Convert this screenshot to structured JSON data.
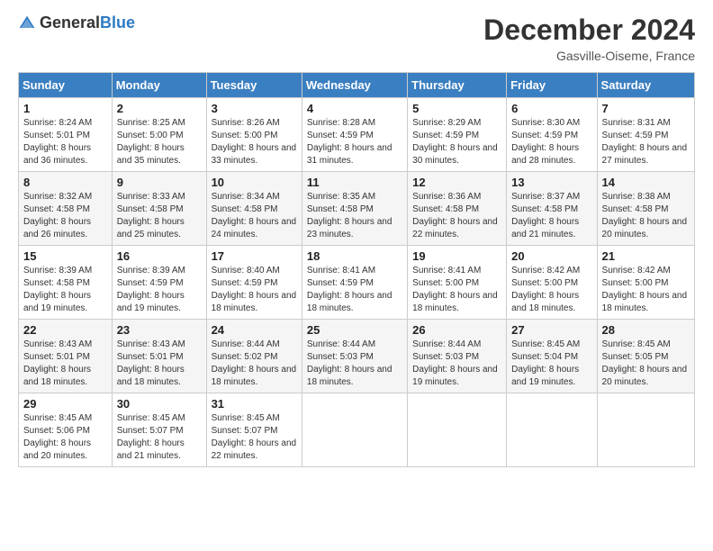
{
  "header": {
    "logo_general": "General",
    "logo_blue": "Blue",
    "month_title": "December 2024",
    "location": "Gasville-Oiseme, France"
  },
  "columns": [
    "Sunday",
    "Monday",
    "Tuesday",
    "Wednesday",
    "Thursday",
    "Friday",
    "Saturday"
  ],
  "weeks": [
    [
      {
        "day": "1",
        "sunrise": "8:24 AM",
        "sunset": "5:01 PM",
        "daylight": "8 hours and 36 minutes."
      },
      {
        "day": "2",
        "sunrise": "8:25 AM",
        "sunset": "5:00 PM",
        "daylight": "8 hours and 35 minutes."
      },
      {
        "day": "3",
        "sunrise": "8:26 AM",
        "sunset": "5:00 PM",
        "daylight": "8 hours and 33 minutes."
      },
      {
        "day": "4",
        "sunrise": "8:28 AM",
        "sunset": "4:59 PM",
        "daylight": "8 hours and 31 minutes."
      },
      {
        "day": "5",
        "sunrise": "8:29 AM",
        "sunset": "4:59 PM",
        "daylight": "8 hours and 30 minutes."
      },
      {
        "day": "6",
        "sunrise": "8:30 AM",
        "sunset": "4:59 PM",
        "daylight": "8 hours and 28 minutes."
      },
      {
        "day": "7",
        "sunrise": "8:31 AM",
        "sunset": "4:59 PM",
        "daylight": "8 hours and 27 minutes."
      }
    ],
    [
      {
        "day": "8",
        "sunrise": "8:32 AM",
        "sunset": "4:58 PM",
        "daylight": "8 hours and 26 minutes."
      },
      {
        "day": "9",
        "sunrise": "8:33 AM",
        "sunset": "4:58 PM",
        "daylight": "8 hours and 25 minutes."
      },
      {
        "day": "10",
        "sunrise": "8:34 AM",
        "sunset": "4:58 PM",
        "daylight": "8 hours and 24 minutes."
      },
      {
        "day": "11",
        "sunrise": "8:35 AM",
        "sunset": "4:58 PM",
        "daylight": "8 hours and 23 minutes."
      },
      {
        "day": "12",
        "sunrise": "8:36 AM",
        "sunset": "4:58 PM",
        "daylight": "8 hours and 22 minutes."
      },
      {
        "day": "13",
        "sunrise": "8:37 AM",
        "sunset": "4:58 PM",
        "daylight": "8 hours and 21 minutes."
      },
      {
        "day": "14",
        "sunrise": "8:38 AM",
        "sunset": "4:58 PM",
        "daylight": "8 hours and 20 minutes."
      }
    ],
    [
      {
        "day": "15",
        "sunrise": "8:39 AM",
        "sunset": "4:58 PM",
        "daylight": "8 hours and 19 minutes."
      },
      {
        "day": "16",
        "sunrise": "8:39 AM",
        "sunset": "4:59 PM",
        "daylight": "8 hours and 19 minutes."
      },
      {
        "day": "17",
        "sunrise": "8:40 AM",
        "sunset": "4:59 PM",
        "daylight": "8 hours and 18 minutes."
      },
      {
        "day": "18",
        "sunrise": "8:41 AM",
        "sunset": "4:59 PM",
        "daylight": "8 hours and 18 minutes."
      },
      {
        "day": "19",
        "sunrise": "8:41 AM",
        "sunset": "5:00 PM",
        "daylight": "8 hours and 18 minutes."
      },
      {
        "day": "20",
        "sunrise": "8:42 AM",
        "sunset": "5:00 PM",
        "daylight": "8 hours and 18 minutes."
      },
      {
        "day": "21",
        "sunrise": "8:42 AM",
        "sunset": "5:00 PM",
        "daylight": "8 hours and 18 minutes."
      }
    ],
    [
      {
        "day": "22",
        "sunrise": "8:43 AM",
        "sunset": "5:01 PM",
        "daylight": "8 hours and 18 minutes."
      },
      {
        "day": "23",
        "sunrise": "8:43 AM",
        "sunset": "5:01 PM",
        "daylight": "8 hours and 18 minutes."
      },
      {
        "day": "24",
        "sunrise": "8:44 AM",
        "sunset": "5:02 PM",
        "daylight": "8 hours and 18 minutes."
      },
      {
        "day": "25",
        "sunrise": "8:44 AM",
        "sunset": "5:03 PM",
        "daylight": "8 hours and 18 minutes."
      },
      {
        "day": "26",
        "sunrise": "8:44 AM",
        "sunset": "5:03 PM",
        "daylight": "8 hours and 19 minutes."
      },
      {
        "day": "27",
        "sunrise": "8:45 AM",
        "sunset": "5:04 PM",
        "daylight": "8 hours and 19 minutes."
      },
      {
        "day": "28",
        "sunrise": "8:45 AM",
        "sunset": "5:05 PM",
        "daylight": "8 hours and 20 minutes."
      }
    ],
    [
      {
        "day": "29",
        "sunrise": "8:45 AM",
        "sunset": "5:06 PM",
        "daylight": "8 hours and 20 minutes."
      },
      {
        "day": "30",
        "sunrise": "8:45 AM",
        "sunset": "5:07 PM",
        "daylight": "8 hours and 21 minutes."
      },
      {
        "day": "31",
        "sunrise": "8:45 AM",
        "sunset": "5:07 PM",
        "daylight": "8 hours and 22 minutes."
      },
      null,
      null,
      null,
      null
    ]
  ],
  "labels": {
    "sunrise": "Sunrise:",
    "sunset": "Sunset:",
    "daylight": "Daylight:"
  }
}
